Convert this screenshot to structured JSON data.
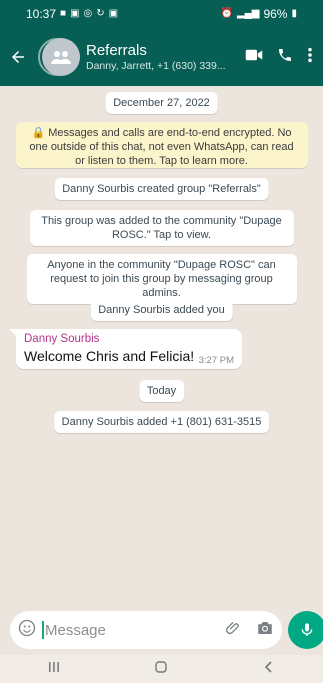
{
  "statusbar": {
    "time": "10:37",
    "battery": "96%"
  },
  "header": {
    "title": "Referrals",
    "subtitle": "Danny, Jarrett, +1 (630) 339..."
  },
  "messages": {
    "date_chip": "December 27, 2022",
    "encryption": "🔒 Messages and calls are end-to-end encrypted. No one outside of this chat, not even WhatsApp, can read or listen to them. Tap to learn more.",
    "created": "Danny Sourbis created group \"Referrals\"",
    "community_added": "This group was added to the community \"Dupage ROSC.\" Tap to view.",
    "community_request": "Anyone in the community \"Dupage ROSC\" can request to join this group by messaging group admins.",
    "added_you": "Danny Sourbis added you",
    "bubble": {
      "sender": "Danny Sourbis",
      "text": "Welcome Chris and Felicia!",
      "time": "3:27 PM"
    },
    "today_chip": "Today",
    "added_number": "Danny Sourbis added +1 (801) 631-3515"
  },
  "composer": {
    "placeholder": "Message"
  },
  "icons": {
    "back": "arrow-left-icon",
    "video": "video-call-icon",
    "call": "phone-icon",
    "menu": "more-vertical-icon",
    "emoji": "emoji-icon",
    "attach": "paperclip-icon",
    "camera": "camera-icon",
    "mic": "microphone-icon"
  },
  "colors": {
    "header": "#075E54",
    "chat_bg": "#ECE5DD",
    "encryption_bg": "#FCF4CB",
    "sender": "#B5338A",
    "accent": "#00A884"
  }
}
